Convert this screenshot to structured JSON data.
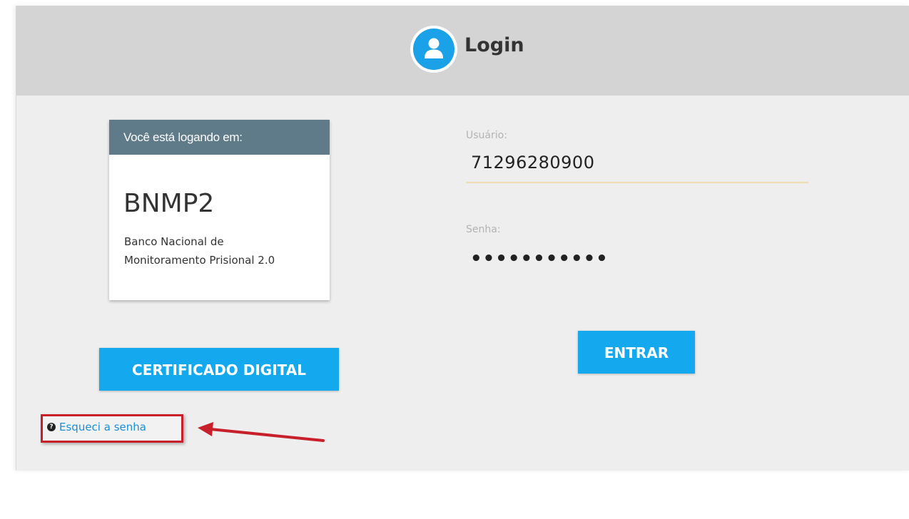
{
  "header": {
    "title": "Login",
    "icon": "user-icon",
    "accent_color": "#1ba1e8"
  },
  "system_card": {
    "caption": "Você está logando em:",
    "name": "BNMP2",
    "description": "Banco Nacional de\nMonitoramento Prisional 2.0"
  },
  "form": {
    "username": {
      "label": "Usuário:",
      "value": "71296280900"
    },
    "password": {
      "label": "Senha:",
      "value": "•••••••••••"
    },
    "submit_label": "ENTRAR"
  },
  "certificate_button_label": "CERTIFICADO DIGITAL",
  "forgot_password": {
    "icon": "question-circle-icon",
    "label": "Esqueci a senha"
  },
  "annotation": {
    "highlight_color": "#c8202a",
    "arrow": "red-arrow"
  },
  "button_color": "#14a8ef"
}
